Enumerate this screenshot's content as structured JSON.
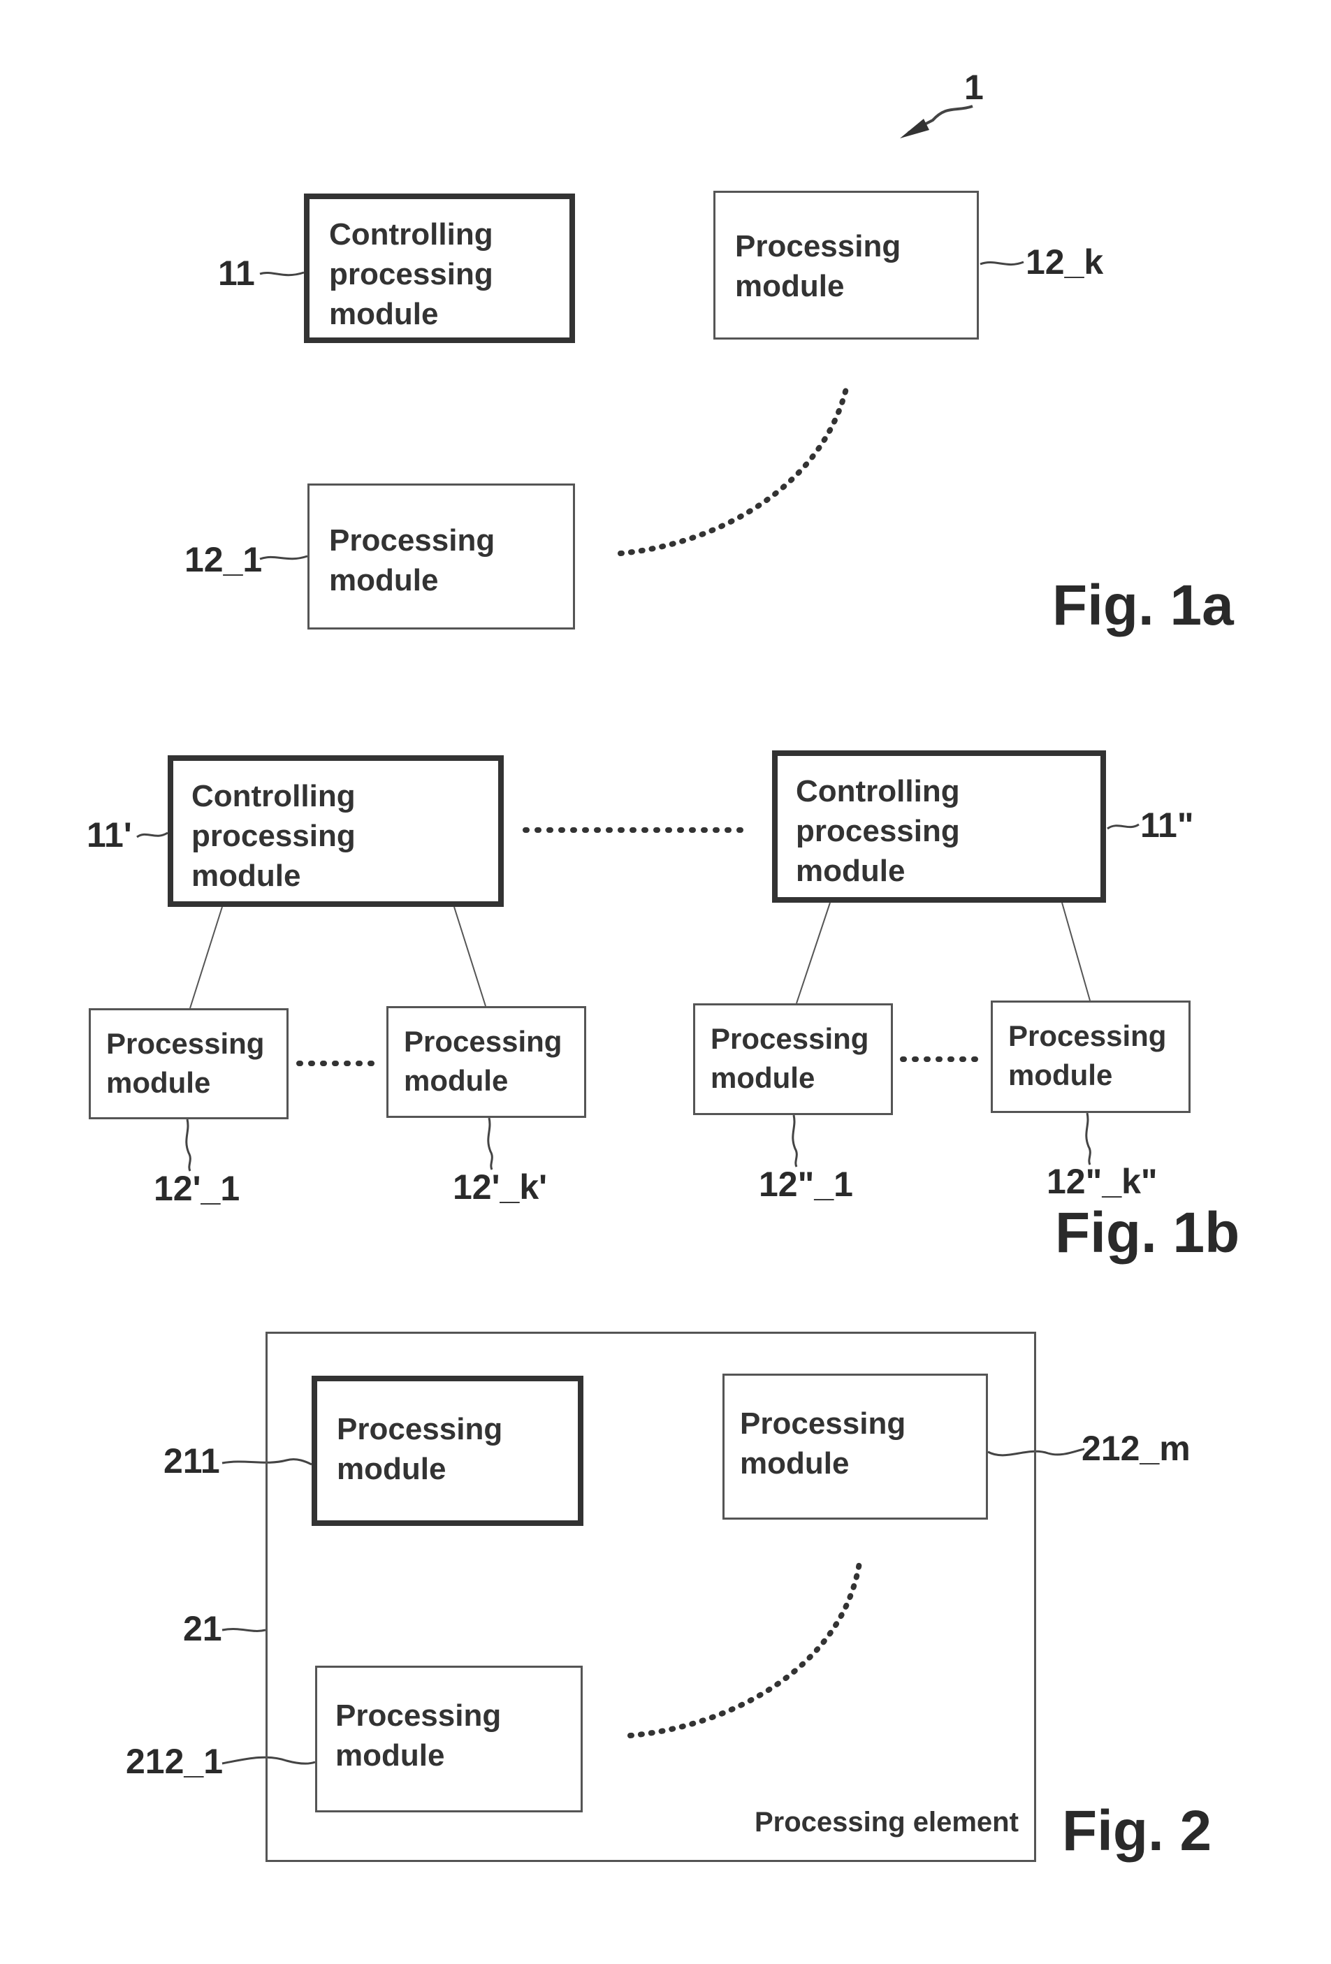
{
  "fig1a": {
    "caption": "Fig. 1a",
    "system_ref": "1",
    "controlling_module": {
      "ref": "11",
      "label": "Controlling\nprocessing\nmodule"
    },
    "module_k": {
      "ref": "12_k",
      "label": "Processing\nmodule"
    },
    "module_1": {
      "ref": "12_1",
      "label": "Processing\nmodule"
    }
  },
  "fig1b": {
    "caption": "Fig. 1b",
    "controlling_left": {
      "ref": "11'",
      "label": "Controlling\nprocessing\nmodule"
    },
    "controlling_right": {
      "ref": "11\"",
      "label": "Controlling\nprocessing\nmodule"
    },
    "modules": [
      {
        "ref": "12'_1",
        "label": "Processing\nmodule"
      },
      {
        "ref": "12'_k'",
        "label": "Processing\nmodule"
      },
      {
        "ref": "12\"_1",
        "label": "Processing\nmodule"
      },
      {
        "ref": "12\"_k\"",
        "label": "Processing\nmodule"
      }
    ]
  },
  "fig2": {
    "caption": "Fig. 2",
    "element": {
      "ref": "21",
      "label": "Processing element"
    },
    "controlling_module": {
      "ref": "211",
      "label": "Processing\nmodule"
    },
    "module_m": {
      "ref": "212_m",
      "label": "Processing\nmodule"
    },
    "module_1": {
      "ref": "212_1",
      "label": "Processing\nmodule"
    }
  }
}
